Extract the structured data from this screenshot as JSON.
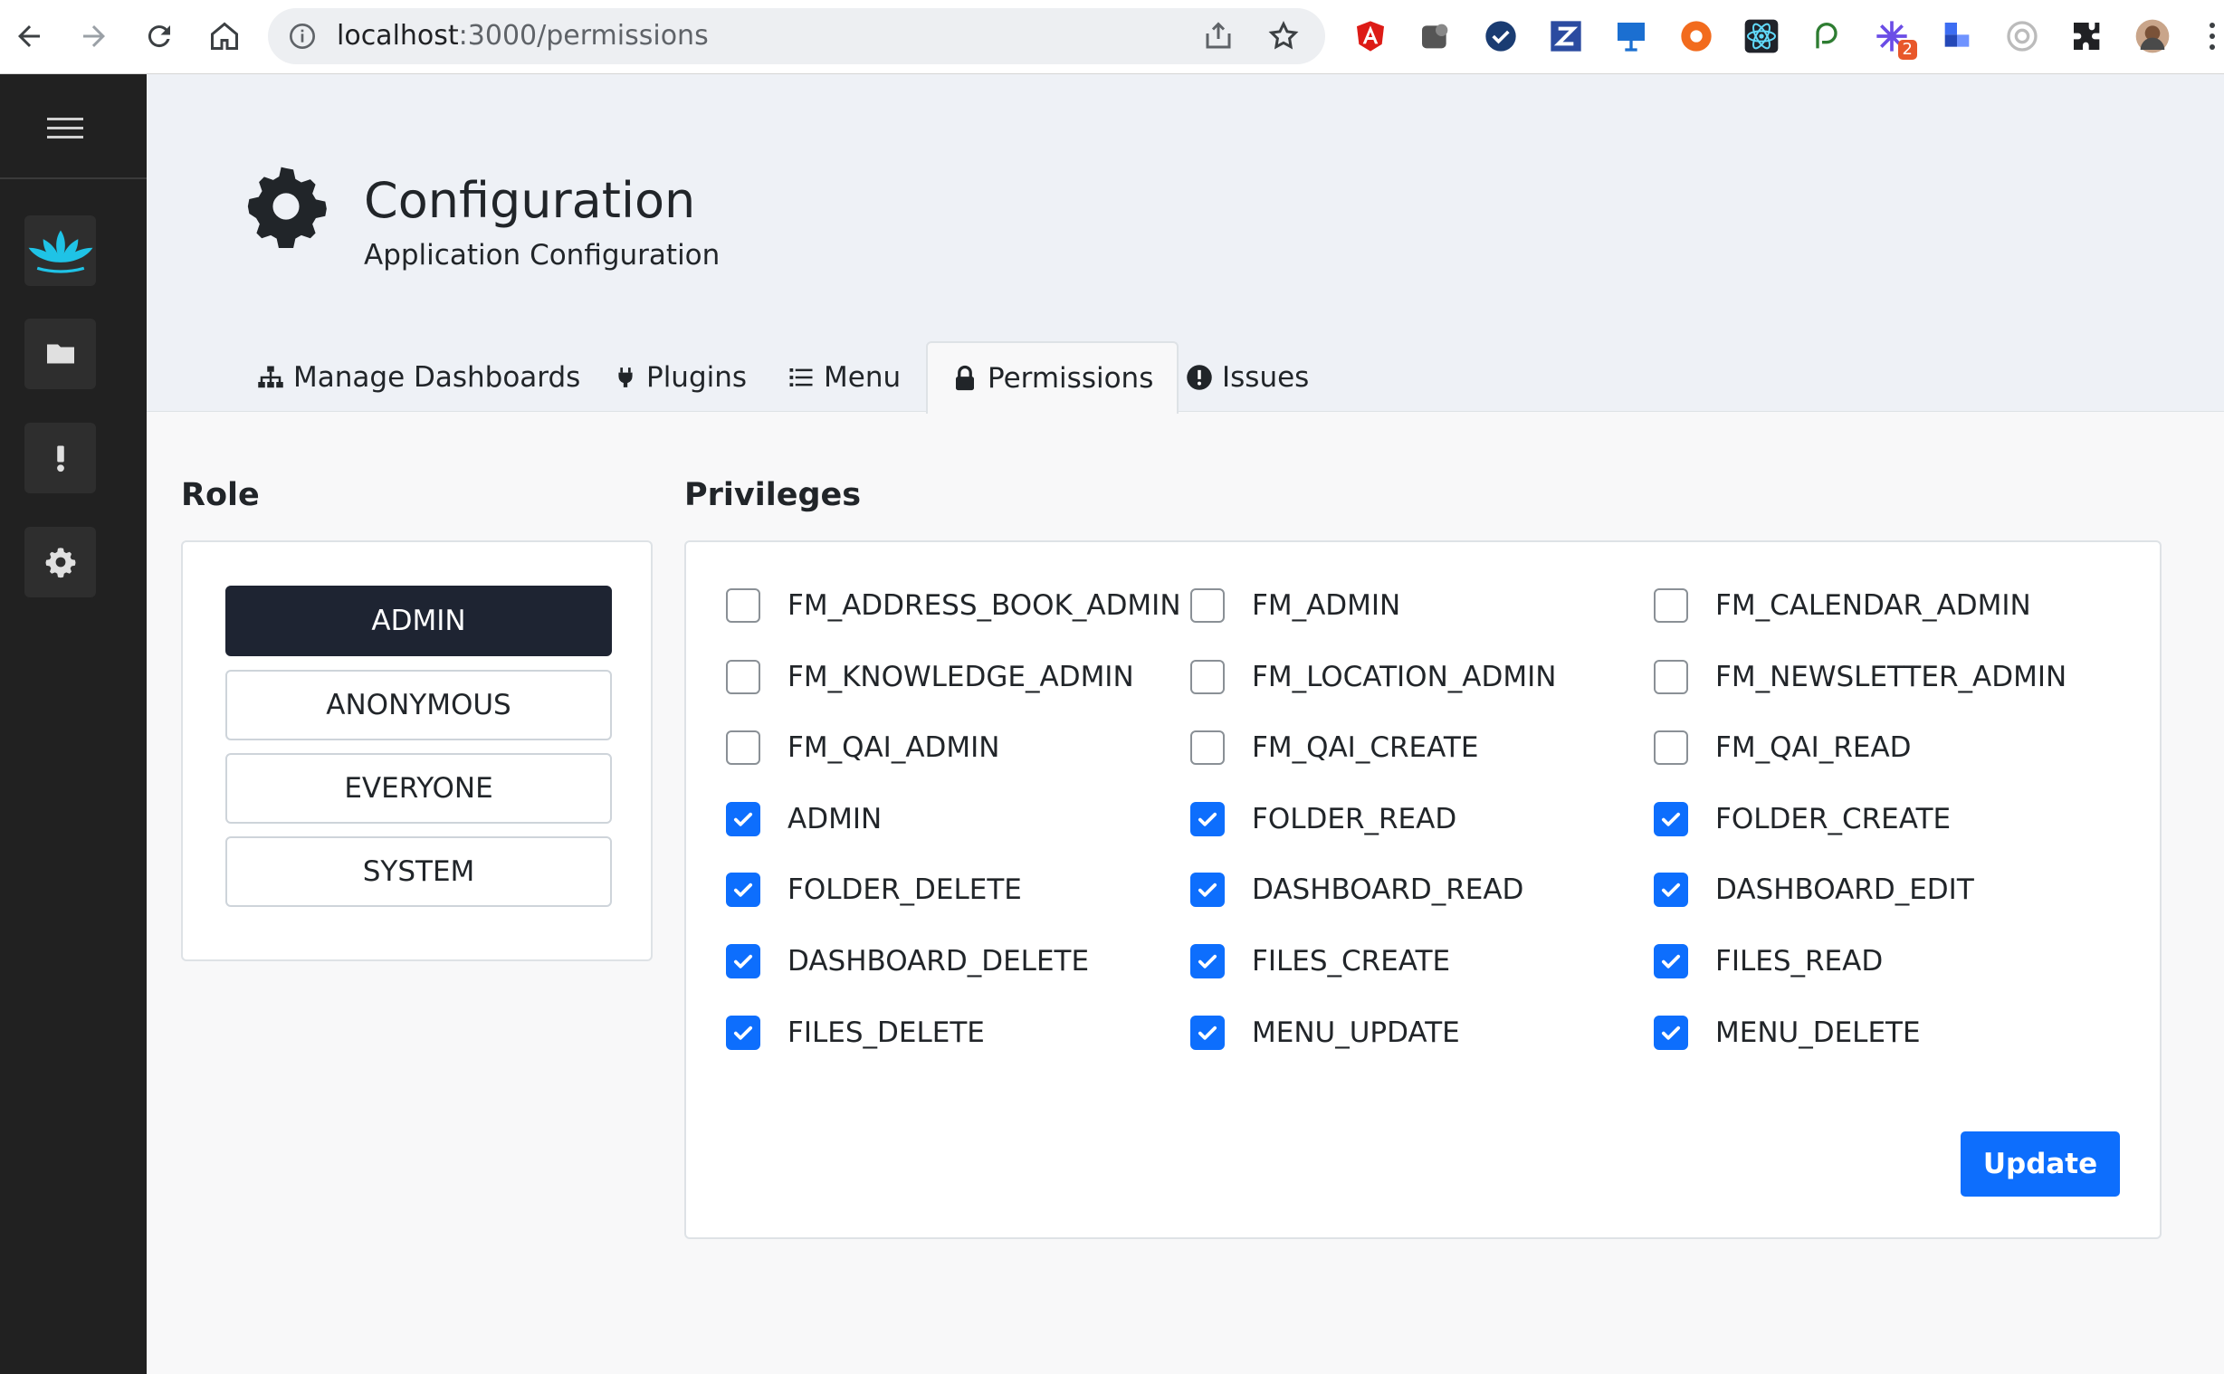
{
  "browser": {
    "url_host": "localhost",
    "url_path": ":3000/permissions",
    "extension_badge": "2"
  },
  "sidebar": {
    "items": [
      {
        "icon": "lotus-logo-icon"
      },
      {
        "icon": "folder-icon"
      },
      {
        "icon": "exclamation-icon"
      },
      {
        "icon": "gear-icon"
      }
    ]
  },
  "header": {
    "title": "Configuration",
    "subtitle": "Application Configuration"
  },
  "tabs": [
    {
      "label": "Manage Dashboards",
      "icon": "sitemap-icon"
    },
    {
      "label": "Plugins",
      "icon": "plug-icon"
    },
    {
      "label": "Menu",
      "icon": "list-icon"
    },
    {
      "label": "Permissions",
      "icon": "lock-icon",
      "active": true
    },
    {
      "label": "Issues",
      "icon": "exclamation-circle-icon"
    }
  ],
  "role": {
    "heading": "Role",
    "selected": "ADMIN",
    "roles": [
      "ADMIN",
      "ANONYMOUS",
      "EVERYONE",
      "SYSTEM"
    ]
  },
  "privileges": {
    "heading": "Privileges",
    "items": [
      {
        "label": "FM_ADDRESS_BOOK_ADMIN",
        "checked": false
      },
      {
        "label": "FM_ADMIN",
        "checked": false
      },
      {
        "label": "FM_CALENDAR_ADMIN",
        "checked": false
      },
      {
        "label": "FM_KNOWLEDGE_ADMIN",
        "checked": false
      },
      {
        "label": "FM_LOCATION_ADMIN",
        "checked": false
      },
      {
        "label": "FM_NEWSLETTER_ADMIN",
        "checked": false
      },
      {
        "label": "FM_QAI_ADMIN",
        "checked": false
      },
      {
        "label": "FM_QAI_CREATE",
        "checked": false
      },
      {
        "label": "FM_QAI_READ",
        "checked": false
      },
      {
        "label": "ADMIN",
        "checked": true
      },
      {
        "label": "FOLDER_READ",
        "checked": true
      },
      {
        "label": "FOLDER_CREATE",
        "checked": true
      },
      {
        "label": "FOLDER_DELETE",
        "checked": true
      },
      {
        "label": "DASHBOARD_READ",
        "checked": true
      },
      {
        "label": "DASHBOARD_EDIT",
        "checked": true
      },
      {
        "label": "DASHBOARD_DELETE",
        "checked": true
      },
      {
        "label": "FILES_CREATE",
        "checked": true
      },
      {
        "label": "FILES_READ",
        "checked": true
      },
      {
        "label": "FILES_DELETE",
        "checked": true
      },
      {
        "label": "MENU_UPDATE",
        "checked": true
      },
      {
        "label": "MENU_DELETE",
        "checked": true
      }
    ],
    "update_label": "Update"
  },
  "colors": {
    "primary": "#0d6efd",
    "sidebar_bg": "#212121",
    "selected_role_bg": "#1e2432",
    "logo_cyan": "#1fc3e6"
  }
}
